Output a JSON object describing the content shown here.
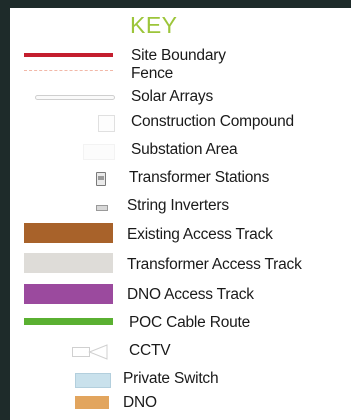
{
  "legend": {
    "title": "KEY",
    "items": [
      {
        "id": "site-boundary",
        "label": "Site Boundary",
        "color": "#c41e2e"
      },
      {
        "id": "fence",
        "label": "Fence",
        "color": "#f2b8a8"
      },
      {
        "id": "solar-arrays",
        "label": "Solar Arrays",
        "color": "#cfcfcf"
      },
      {
        "id": "construction-compound",
        "label": "Construction Compound",
        "color": "#e0e0e0"
      },
      {
        "id": "substation-area",
        "label": "Substation Area",
        "color": "#f3f3f3"
      },
      {
        "id": "transformer-stations",
        "label": "Transformer Stations",
        "color": "#7a7a7a"
      },
      {
        "id": "string-inverters",
        "label": "String Inverters",
        "color": "#9a9a9a"
      },
      {
        "id": "existing-access-track",
        "label": "Existing Access Track",
        "color": "#a8622a"
      },
      {
        "id": "transformer-access-track",
        "label": "Transformer Access Track",
        "color": "#dedcd8"
      },
      {
        "id": "dno-access-track",
        "label": "DNO Access Track",
        "color": "#9b4a9e"
      },
      {
        "id": "poc-cable-route",
        "label": "POC Cable Route",
        "color": "#5ab031"
      },
      {
        "id": "cctv",
        "label": "CCTV",
        "color": "#d6d6d6"
      },
      {
        "id": "private-switch",
        "label": "Private Switch",
        "color": "#c9e1ec"
      },
      {
        "id": "dno",
        "label": "DNO",
        "color": "#e2a55e"
      }
    ]
  }
}
